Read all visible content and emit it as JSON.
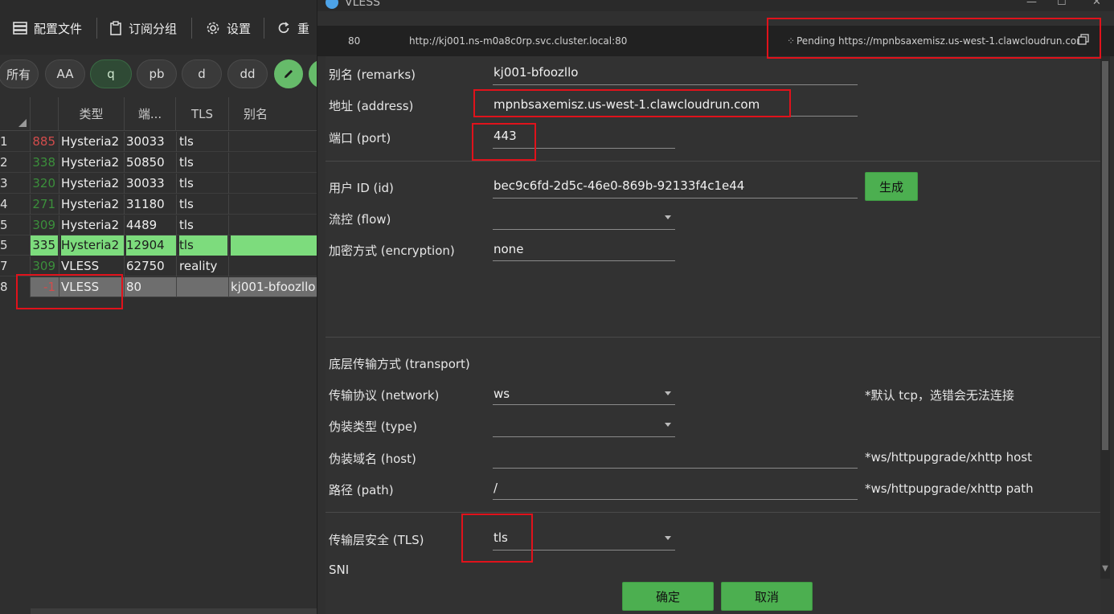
{
  "toolbar": {
    "items": [
      {
        "label": "配置文件",
        "icon": "server-icon"
      },
      {
        "label": "订阅分组",
        "icon": "clipboard-icon"
      },
      {
        "label": "设置",
        "icon": "gear-icon"
      },
      {
        "label": "重",
        "icon": "reload-icon"
      }
    ]
  },
  "filters": {
    "chips": [
      "所有",
      "AA",
      "q",
      "pb",
      "d",
      "dd"
    ],
    "active": "q",
    "edit_icon": "pencil-icon"
  },
  "grid": {
    "headers": [
      "类型",
      "端...",
      "TLS",
      "别名"
    ],
    "rows": [
      {
        "idx": "1",
        "latency": "885",
        "type": "Hysteria2",
        "port": "30033",
        "tls": "tls",
        "remarks": ""
      },
      {
        "idx": "2",
        "latency": "338",
        "type": "Hysteria2",
        "port": "50850",
        "tls": "tls",
        "remarks": ""
      },
      {
        "idx": "3",
        "latency": "320",
        "type": "Hysteria2",
        "port": "30033",
        "tls": "tls",
        "remarks": ""
      },
      {
        "idx": "4",
        "latency": "271",
        "type": "Hysteria2",
        "port": "31180",
        "tls": "tls",
        "remarks": ""
      },
      {
        "idx": "5",
        "latency": "309",
        "type": "Hysteria2",
        "port": "4489",
        "tls": "tls",
        "remarks": ""
      },
      {
        "idx": "5",
        "latency": "335",
        "type": "Hysteria2",
        "port": "12904",
        "tls": "tls",
        "remarks": ""
      },
      {
        "idx": "7",
        "latency": "309",
        "type": "VLESS",
        "port": "62750",
        "tls": "reality",
        "remarks": ""
      },
      {
        "idx": "8",
        "latency": "-1",
        "type": "VLESS",
        "port": "80",
        "tls": "",
        "remarks": "kj001-bfoozllo"
      }
    ]
  },
  "dialog": {
    "title": "VLESS",
    "window_buttons": [
      "—",
      "☐",
      "✕"
    ],
    "urlbar": {
      "port": "80",
      "url": "http://kj001.ns-m0a8c0rp.svc.cluster.local:80",
      "status": "Pending",
      "public_url": "https://mpnbsaxemisz.us-west-1.clawcloudrun.com"
    },
    "fields": {
      "remarks": {
        "label": "别名 (remarks)",
        "value": "kj001-bfoozllo"
      },
      "address": {
        "label": "地址 (address)",
        "value": "mpnbsaxemisz.us-west-1.clawcloudrun.com"
      },
      "port": {
        "label": "端口 (port)",
        "value": "443"
      },
      "id": {
        "label": "用户 ID (id)",
        "value": "bec9c6fd-2d5c-46e0-869b-92133f4c1e44"
      },
      "generate": "生成",
      "flow": {
        "label": "流控 (flow)",
        "value": ""
      },
      "encryption": {
        "label": "加密方式 (encryption)",
        "value": "none"
      },
      "transport_title": "底层传输方式 (transport)",
      "network": {
        "label": "传输协议 (network)",
        "value": "ws",
        "hint": "*默认 tcp，选错会无法连接"
      },
      "type": {
        "label": "伪装类型 (type)",
        "value": ""
      },
      "host": {
        "label": "伪装域名 (host)",
        "value": "",
        "hint": "*ws/httpupgrade/xhttp host"
      },
      "path": {
        "label": "路径 (path)",
        "value": "/",
        "hint": "*ws/httpupgrade/xhttp path"
      },
      "tls": {
        "label": "传输层安全 (TLS)",
        "value": "tls"
      },
      "sni": {
        "label": "SNI"
      }
    },
    "ok": "确定",
    "cancel": "取消"
  },
  "colors": {
    "accent_green": "#4caf50",
    "highlight_red": "#e0121b",
    "latency_good": "#3b8f3b",
    "latency_bad": "#d24c4c"
  }
}
